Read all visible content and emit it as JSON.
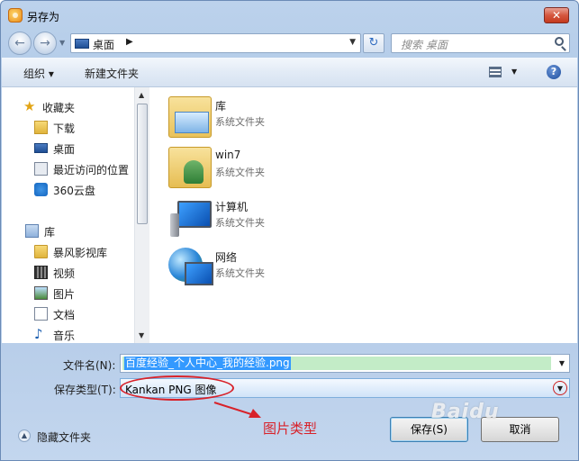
{
  "window": {
    "title": "另存为",
    "close_label": "✕"
  },
  "nav": {
    "back_icon": "←",
    "forward_icon": "→",
    "address": "桌面",
    "address_arrow": "▶",
    "refresh_icon": "↻",
    "search_placeholder": "搜索 桌面"
  },
  "toolbar": {
    "organize_label": "组织 ▾",
    "new_folder_label": "新建文件夹",
    "help_label": "?"
  },
  "sidebar": {
    "items": [
      {
        "label": "收藏夹",
        "icon": "star-icon"
      },
      {
        "label": "下载",
        "icon": "download-folder-icon"
      },
      {
        "label": "桌面",
        "icon": "desktop-icon"
      },
      {
        "label": "最近访问的位置",
        "icon": "recent-places-icon"
      },
      {
        "label": "360云盘",
        "icon": "cloud-icon"
      },
      {
        "label": "库",
        "icon": "library-icon"
      },
      {
        "label": "暴风影视库",
        "icon": "folder-icon"
      },
      {
        "label": "视频",
        "icon": "video-icon"
      },
      {
        "label": "图片",
        "icon": "picture-icon"
      },
      {
        "label": "文档",
        "icon": "document-icon"
      },
      {
        "label": "音乐",
        "icon": "music-icon"
      }
    ]
  },
  "files": [
    {
      "name": "库",
      "type": "系统文件夹",
      "icon": "library-folder-icon"
    },
    {
      "name": "win7",
      "type": "系统文件夹",
      "icon": "user-folder-icon"
    },
    {
      "name": "计算机",
      "type": "系统文件夹",
      "icon": "computer-icon"
    },
    {
      "name": "网络",
      "type": "系统文件夹",
      "icon": "network-icon"
    }
  ],
  "form": {
    "filename_label": "文件名(N):",
    "filename_value": "百度经验_个人中心_我的经验.png",
    "filetype_label": "保存类型(T):",
    "filetype_value": "Kankan PNG 图像",
    "hide_folders_label": "隐藏文件夹",
    "save_label": "保存(S)",
    "cancel_label": "取消"
  },
  "annotation": {
    "text": "图片类型",
    "color": "#d8222a"
  },
  "watermark": "Baidu"
}
